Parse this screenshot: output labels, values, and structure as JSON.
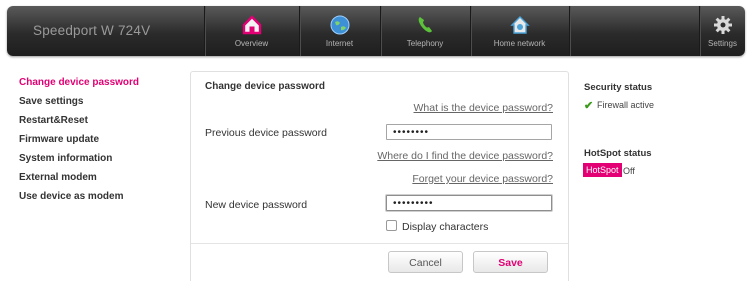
{
  "brand": "Speedport W 724V",
  "nav": {
    "overview": "Overview",
    "internet": "Internet",
    "telephony": "Telephony",
    "home_network": "Home network",
    "settings": "Settings"
  },
  "sidebar": {
    "items": [
      {
        "label": "Change device password",
        "active": true
      },
      {
        "label": "Save settings"
      },
      {
        "label": "Restart&Reset"
      },
      {
        "label": "Firmware update"
      },
      {
        "label": "System information"
      },
      {
        "label": "External modem"
      },
      {
        "label": "Use device as modem"
      }
    ]
  },
  "panel": {
    "title": "Change device password",
    "link_what": "What is the device password?",
    "previous_label": "Previous device password",
    "previous_value": "••••••••",
    "link_where": "Where do I find the device password?",
    "link_forgot": "Forget your device password?",
    "new_label": "New device password",
    "new_value": "•••••••••",
    "display_chars": "Display characters",
    "cancel": "Cancel",
    "save": "Save"
  },
  "status": {
    "security_title": "Security status",
    "firewall": "Firewall active",
    "hotspot_title": "HotSpot status",
    "hotspot_badge": "HotSpot",
    "hotspot_state": "Off"
  },
  "colors": {
    "accent": "#e20074",
    "ok": "#3c9a1b"
  }
}
